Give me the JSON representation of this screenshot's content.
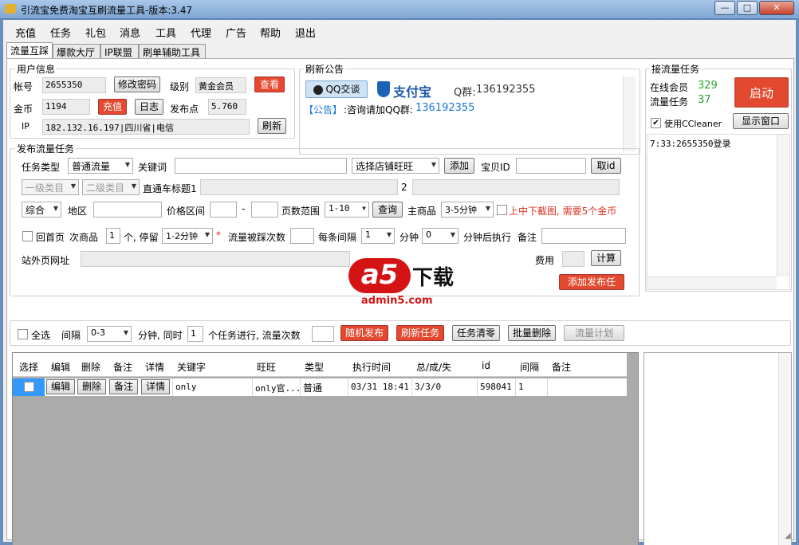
{
  "window": {
    "title": "引流宝免费淘宝互刷流量工具-版本:3.47",
    "minimize": "—",
    "maximize": "□",
    "close": "✕"
  },
  "menu": [
    "充值",
    "任务",
    "礼包",
    "消息",
    "工具",
    "代理",
    "广告",
    "帮助",
    "退出"
  ],
  "tabs": [
    "流量互踩",
    "爆款大厅",
    "IP联盟",
    "刷单辅助工具"
  ],
  "user_info": {
    "title": "用户信息",
    "account_label": "帐号",
    "account": "2655350",
    "change_pwd": "修改密码",
    "level_label": "级别",
    "level": "黄金会员",
    "check_btn": "查看",
    "gold_label": "金币",
    "gold": "1194",
    "recharge_btn": "充值",
    "log_btn": "日志",
    "publish_points_label": "发布点",
    "publish_points": "5.760",
    "ip_label": "IP",
    "ip": "182.132.16.197|四川省|电信",
    "refresh_btn": "刷新"
  },
  "notice": {
    "title": "刷新公告",
    "qq_btn": "QQ交谈",
    "alipay": "支付宝",
    "qq_group_label": "Q群:",
    "qq_group": "136192355",
    "line_prefix": "【公告】",
    "line_text": ":咨询请加QQ群:",
    "line_num": "136192355"
  },
  "receive": {
    "title": "接流量任务",
    "online_label": "在线会员",
    "online": "329",
    "tasks_label": "流量任务",
    "tasks": "37",
    "start_btn": "启动",
    "ccleaner_label": "使用CCleaner",
    "ccleaner_checked": true,
    "show_window_btn": "显示窗口",
    "log": "7:33:2655350登录"
  },
  "publish": {
    "title": "发布流量任务",
    "task_type_label": "任务类型",
    "task_type": "普通流量",
    "keyword_label": "关键词",
    "keyword": "",
    "shop_select": "选择店铺旺旺",
    "add_btn": "添加",
    "item_id_label": "宝贝ID",
    "item_id": "",
    "get_id_btn": "取id",
    "cat1": "一级类目",
    "cat2": "二级类目",
    "title1_label": "直通车标题1",
    "title1": "",
    "title2_label": "2",
    "title2": "",
    "sort": "综合",
    "region_label": "地区",
    "region": "",
    "price_label": "价格区间",
    "price_min": "",
    "price_dash": "-",
    "price_max": "",
    "page_range_label": "页数范围",
    "page_range": "1-10",
    "query_btn": "查询",
    "main_item_label": "主商品",
    "main_item": "3-5分钟",
    "screenshot_label": "上中下截图, 需要5个金币",
    "home_label": "回首页",
    "sub_item_label": "次商品",
    "sub_item_count": "1",
    "stay_label": "个, 停留",
    "stay": "1-2分钟",
    "star": "*",
    "flow_times_label": "流量被踩次数",
    "flow_times": "",
    "interval_label": "每条间隔",
    "interval": "1",
    "minute_label": "分钟",
    "after_value": "0",
    "after_label": "分钟后执行",
    "remark_label": "备注",
    "remark": "",
    "url_label": "站外页网址",
    "url": "",
    "cost_label": "费用",
    "cost": "",
    "calc_btn": "计算",
    "add_publish_btn": "添加发布任"
  },
  "watermark": {
    "brand": "a5",
    "cn": "下载",
    "site": "admin5.com"
  },
  "toolbar": {
    "select_all": "全选",
    "interval_label": "间隔",
    "interval": "0-3",
    "minute_label": "分钟, 同时",
    "concurrent": "1",
    "concurrent_label": "个任务进行, 流量次数",
    "flow_count": "",
    "random_btn": "随机发布",
    "refresh_btn": "刷新任务",
    "clear_btn": "任务清零",
    "batch_delete_btn": "批量删除",
    "plan_btn": "流量计划"
  },
  "table": {
    "columns": [
      "选择",
      "编辑",
      "删除",
      "备注",
      "详情",
      "关键字",
      "旺旺",
      "类型",
      "执行时间",
      "总/成/失",
      "id",
      "间隔",
      "备注"
    ],
    "rows": [
      {
        "edit": "编辑",
        "delete": "删除",
        "remark_btn": "备注",
        "detail": "详情",
        "keyword": "only",
        "wangwang": "only官...",
        "type": "普通",
        "time": "03/31 18:41",
        "stats": "3/3/0",
        "id": "598041",
        "interval": "1",
        "remark": ""
      }
    ]
  }
}
